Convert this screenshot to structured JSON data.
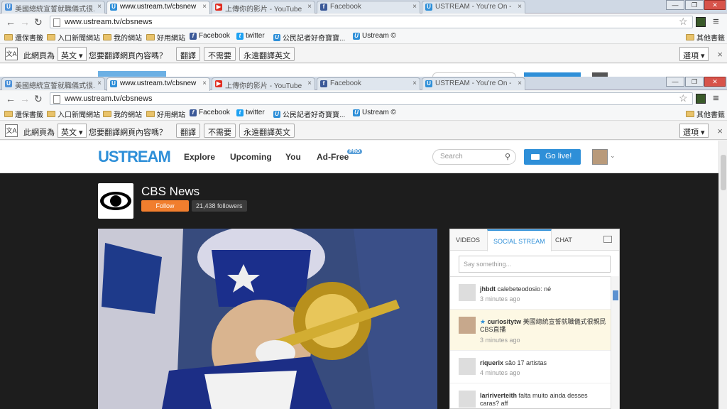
{
  "tabs": [
    {
      "label": "美國總統宣誓就職儀式很...",
      "icon": "ustream-icon",
      "color": "#4a90d9"
    },
    {
      "label": "www.ustream.tv/cbsnew",
      "icon": "ustream-icon",
      "color": "#2e8fd8"
    },
    {
      "label": "上傳你的影片 - YouTube",
      "icon": "youtube-icon",
      "color": "#e02b20"
    },
    {
      "label": "Facebook",
      "icon": "facebook-icon",
      "color": "#3b5998"
    },
    {
      "label": "USTREAM - You're On -",
      "icon": "ustream-icon",
      "color": "#2e8fd8"
    }
  ],
  "toolbar": {
    "url": "www.ustream.tv/cbsnews"
  },
  "bookmarks": [
    {
      "label": "還保書籤",
      "type": "folder"
    },
    {
      "label": "入口新聞網站",
      "type": "folder"
    },
    {
      "label": "我的網站",
      "type": "folder"
    },
    {
      "label": "好用網站",
      "type": "folder"
    },
    {
      "label": "Facebook",
      "type": "facebook"
    },
    {
      "label": "twitter",
      "type": "twitter"
    },
    {
      "label": "公民記者好奇寶寶...",
      "type": "ustream"
    },
    {
      "label": "Ustream ©",
      "type": "ustream"
    },
    {
      "label": "其他書籤",
      "type": "folder"
    }
  ],
  "translate": {
    "prefix": "此網頁為",
    "language": "英文",
    "question": "您要翻譯網頁內容嗎？",
    "translate_btn": "翻譯",
    "no_btn": "不需要",
    "always_btn": "永遠翻譯英文",
    "options": "選項"
  },
  "ustream": {
    "logo": "USTREAM",
    "nav": [
      "Explore",
      "Upcoming",
      "You",
      "Ad-Free"
    ],
    "pro": "PRO",
    "search_placeholder": "Search",
    "go_live": "Go live!"
  },
  "channel": {
    "title": "CBS News",
    "follow": "Follow",
    "followers": "21,438 followers"
  },
  "panel": {
    "tabs": [
      "VIDEOS",
      "SOCIAL STREAM",
      "CHAT"
    ],
    "say_placeholder": "Say something...",
    "items": [
      {
        "user": "jhbdt",
        "text": "calebeteodosio: né",
        "time": "3 minutes ago",
        "highlight": false
      },
      {
        "user": "curiositytw",
        "text": "美國總統宣誓就職儀式很親民 CBS直播",
        "time": "3 minutes ago",
        "highlight": true
      },
      {
        "user": "riquerix",
        "text": "são 17 artistas",
        "time": "4 minutes ago",
        "highlight": false
      },
      {
        "user": "laririverteith",
        "text": "falta muito ainda desses caras? aff",
        "time": "",
        "highlight": false
      }
    ]
  },
  "colors": {
    "accent": "#2e8fd8",
    "follow": "#f17e2e",
    "dark": "#1d1d1d"
  }
}
